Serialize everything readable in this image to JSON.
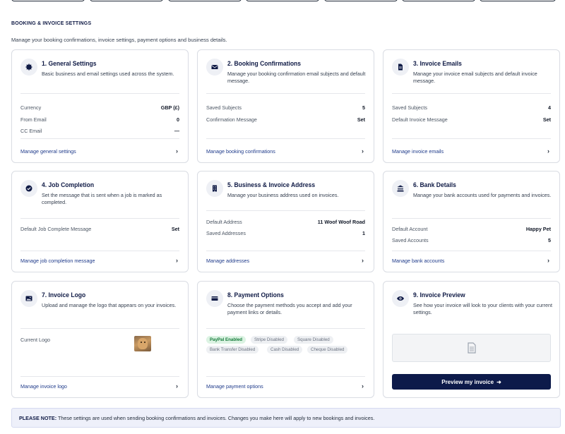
{
  "top_tabs_count": 7,
  "section": {
    "title": "BOOKING & INVOICE SETTINGS",
    "description": "Manage your booking confirmations, invoice settings, payment options and business details."
  },
  "cards": {
    "general": {
      "title": "1. General Settings",
      "subtitle": "Basic business and email settings used across the system.",
      "icon": "gear-icon",
      "rows": [
        {
          "label": "Currency",
          "value": "GBP (£)"
        },
        {
          "label": "From Email",
          "value": "0"
        },
        {
          "label": "CC Email",
          "value": "—"
        }
      ],
      "link": "Manage general settings"
    },
    "booking": {
      "title": "2. Booking Confirmations",
      "subtitle": "Manage your booking confirmation email subjects and default message.",
      "icon": "envelope-icon",
      "rows": [
        {
          "label": "Saved Subjects",
          "value": "5"
        },
        {
          "label": "Confirmation Message",
          "value": "Set"
        }
      ],
      "link": "Manage booking confirmations"
    },
    "invoice_emails": {
      "title": "3. Invoice Emails",
      "subtitle": "Manage your invoice email subjects and default invoice message.",
      "icon": "document-icon",
      "rows": [
        {
          "label": "Saved Subjects",
          "value": "4"
        },
        {
          "label": "Default Invoice Message",
          "value": "Set"
        }
      ],
      "link": "Manage invoice emails"
    },
    "job": {
      "title": "4. Job Completion",
      "subtitle": "Set the message that is sent when a job is marked as completed.",
      "icon": "check-circle-icon",
      "rows": [
        {
          "label": "Default Job Complete Message",
          "value": "Set"
        }
      ],
      "link": "Manage job completion message"
    },
    "address": {
      "title": "5. Business & Invoice Address",
      "subtitle": "Manage your business address used on invoices.",
      "icon": "building-icon",
      "rows": [
        {
          "label": "Default Address",
          "value": "11 Woof Woof Road"
        },
        {
          "label": "Saved Addresses",
          "value": "1"
        }
      ],
      "link": "Manage addresses"
    },
    "bank": {
      "title": "6. Bank Details",
      "subtitle": "Manage your bank accounts used for payments and invoices.",
      "icon": "bank-icon",
      "rows": [
        {
          "label": "Default Account",
          "value": "Happy Pet"
        },
        {
          "label": "Saved Accounts",
          "value": "5"
        }
      ],
      "link": "Manage bank accounts"
    },
    "logo": {
      "title": "7. Invoice Logo",
      "subtitle": "Upload and manage the logo that appears on your invoices.",
      "icon": "image-icon",
      "rows": [
        {
          "label": "Current Logo",
          "value": ""
        }
      ],
      "link": "Manage invoice logo"
    },
    "payment": {
      "title": "8. Payment Options",
      "subtitle": "Choose the payment methods you accept and add your payment links or details.",
      "icon": "card-icon",
      "chips": [
        {
          "label": "PayPal Enabled",
          "enabled": true
        },
        {
          "label": "Stripe Disabled",
          "enabled": false
        },
        {
          "label": "Square Disabled",
          "enabled": false
        },
        {
          "label": "Bank Transfer Disabled",
          "enabled": false
        },
        {
          "label": "Cash Disabled",
          "enabled": false
        },
        {
          "label": "Cheque Disabled",
          "enabled": false
        }
      ],
      "link": "Manage payment options"
    },
    "preview": {
      "title": "9. Invoice Preview",
      "subtitle": "See how your invoice will look to your clients with your current settings.",
      "icon": "eye-icon",
      "button": "Preview my invoice"
    }
  },
  "note": {
    "label": "PLEASE NOTE:",
    "text": "These settings are used when sending booking confirmations and invoices. Changes you make here will apply to new bookings and invoices."
  },
  "colors": {
    "navy": "#0f1a45",
    "button": "#0d1a4a",
    "link": "#1e3a8a",
    "chip_on_bg": "#dcf3e3",
    "chip_on_text": "#157a3a"
  }
}
